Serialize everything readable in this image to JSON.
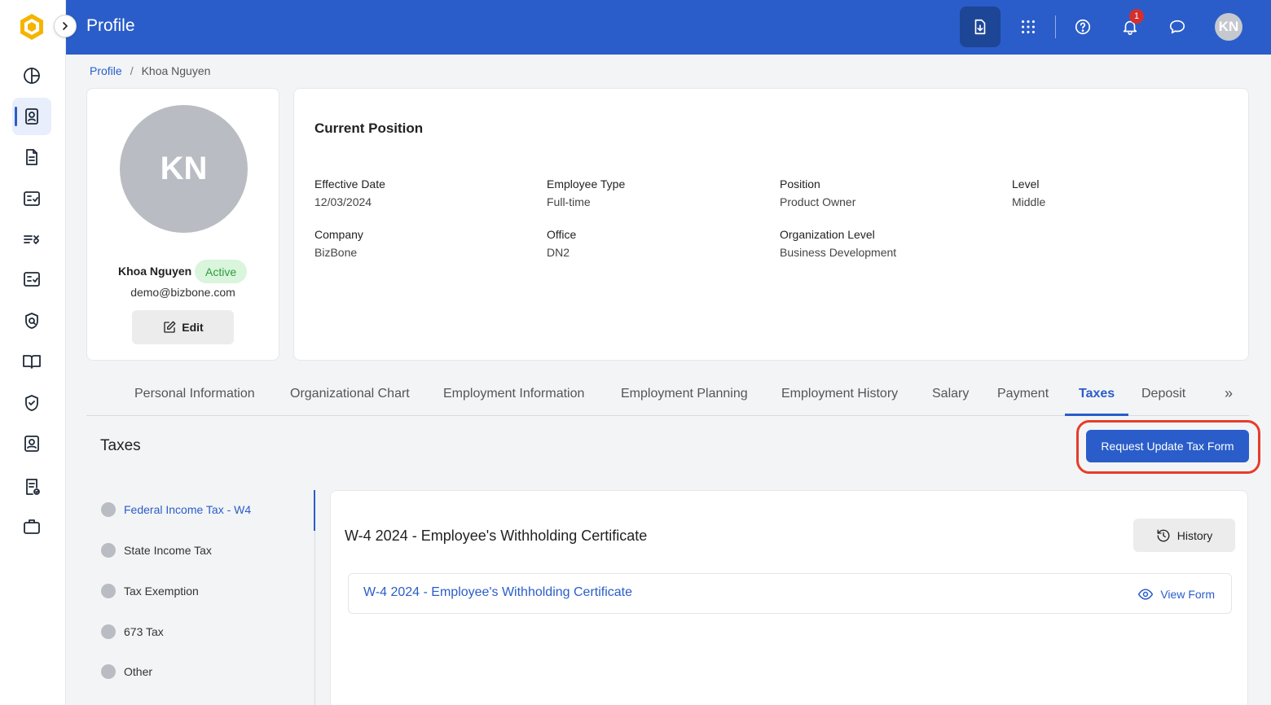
{
  "header": {
    "title": "Profile",
    "notification_count": "1",
    "avatar_initials": "KN"
  },
  "breadcrumb": {
    "root": "Profile",
    "separator": "/",
    "current": "Khoa Nguyen"
  },
  "sidebar": {
    "items": [
      {
        "icon": "dashboard-icon"
      },
      {
        "icon": "profile-icon",
        "active": true
      },
      {
        "icon": "document-icon"
      },
      {
        "icon": "checklist-icon"
      },
      {
        "icon": "task-list-icon"
      },
      {
        "icon": "checklist-2-icon"
      },
      {
        "icon": "security-search-icon"
      },
      {
        "icon": "book-icon"
      },
      {
        "icon": "shield-check-icon"
      },
      {
        "icon": "contact-card-icon"
      },
      {
        "icon": "approved-document-icon"
      },
      {
        "icon": "briefcase-icon"
      }
    ]
  },
  "profile": {
    "initials": "KN",
    "name": "Khoa Nguyen",
    "status": "Active",
    "email": "demo@bizbone.com",
    "edit_label": "Edit"
  },
  "position": {
    "title": "Current Position",
    "fields": [
      {
        "label": "Effective Date",
        "value": "12/03/2024"
      },
      {
        "label": "Employee Type",
        "value": "Full-time"
      },
      {
        "label": "Position",
        "value": "Product Owner"
      },
      {
        "label": "Level",
        "value": "Middle"
      },
      {
        "label": "Company",
        "value": "BizBone"
      },
      {
        "label": "Office",
        "value": "DN2"
      },
      {
        "label": "Organization Level",
        "value": "Business Development"
      }
    ]
  },
  "tabs": [
    "Personal Information",
    "Organizational Chart",
    "Employment Information",
    "Employment Planning",
    "Employment History",
    "Salary",
    "Payment",
    "Taxes",
    "Deposit"
  ],
  "tab_more": "»",
  "taxes": {
    "title": "Taxes",
    "request_button": "Request Update Tax Form",
    "nav": [
      "Federal Income Tax - W4",
      "State Income Tax",
      "Tax Exemption",
      "673 Tax",
      "Other"
    ],
    "form_title": "W-4 2024 - Employee's Withholding Certificate",
    "history_label": "History",
    "form_link": "W-4 2024 - Employee's Withholding Certificate",
    "view_form_label": "View Form"
  },
  "colors": {
    "primary": "#2a5dc9",
    "highlight": "#e53d2b",
    "active_badge_bg": "#d9f5dc",
    "active_badge_text": "#2e9c3f"
  }
}
